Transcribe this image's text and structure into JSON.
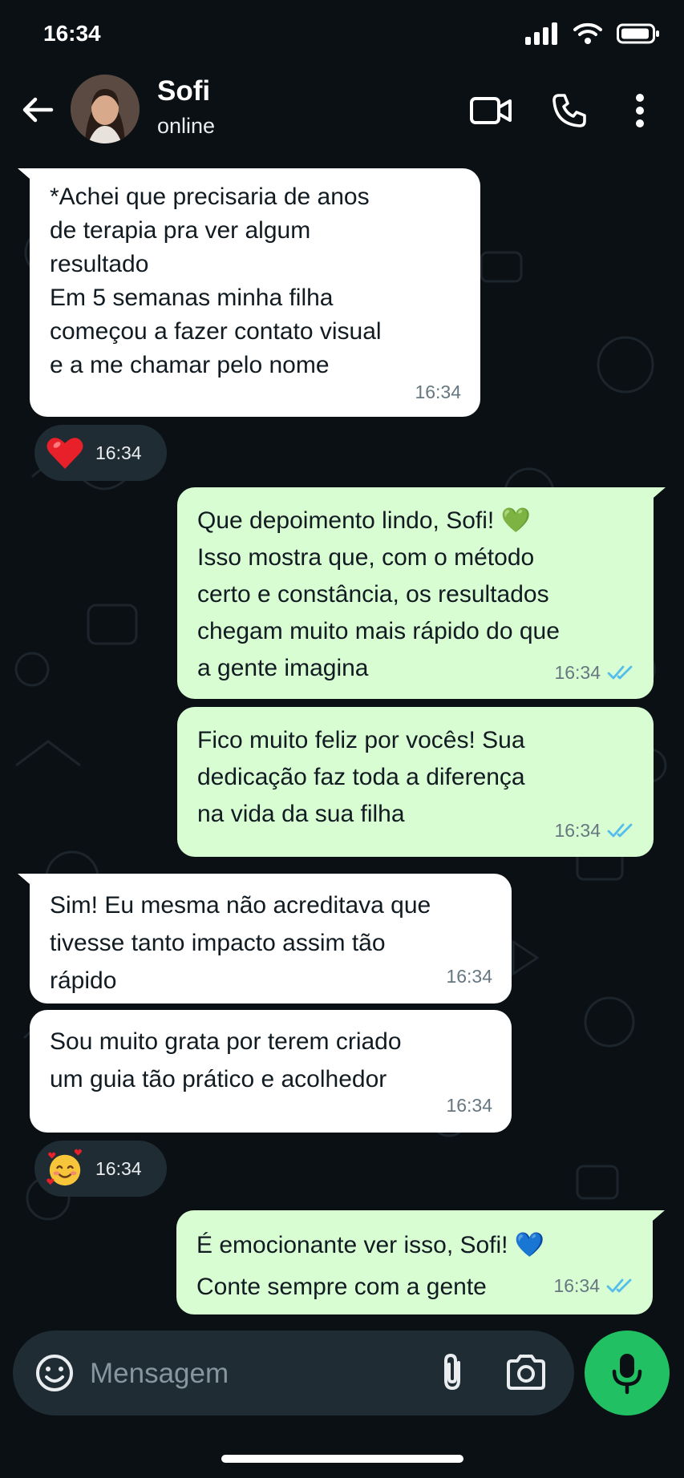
{
  "status_bar": {
    "time": "16:34"
  },
  "header": {
    "contact_name": "Sofi",
    "contact_status": "online",
    "icons": [
      "back-arrow-icon",
      "video-call-icon",
      "phone-icon",
      "more-vert-icon"
    ]
  },
  "messages": [
    {
      "direction": "in",
      "text": "*Achei que precisaria de anos\nde terapia pra ver algum\nresultado\nEm 5 semanas minha filha\ncomeçou a fazer contato visual\ne a me chamar pelo nome",
      "time": "16:34"
    },
    {
      "direction": "in",
      "emoji": "❤️",
      "time": "16:34"
    },
    {
      "direction": "out",
      "text": "Que depoimento lindo, Sofi! 💚\nIsso mostra que, com o método\ncerto e constância, os resultados\nchegam muito mais rápido do que\na gente imagina",
      "time": "16:34",
      "read": true
    },
    {
      "direction": "out",
      "text": "Fico muito feliz por vocês! Sua\ndedicação faz toda a diferença\nna vida da sua filha",
      "time": "16:34",
      "read": true
    },
    {
      "direction": "in",
      "text": "Sim! Eu mesma não acreditava que\ntivesse tanto impacto assim tão\nrápido",
      "time": "16:34"
    },
    {
      "direction": "in",
      "text": "Sou muito grata por terem criado\num guia tão prático e acolhedor",
      "time": "16:34"
    },
    {
      "direction": "in",
      "emoji": "🥰",
      "time": "16:34"
    },
    {
      "direction": "out",
      "text": "É emocionante ver isso, Sofi! 💙\nConte sempre com a gente",
      "time": "16:34",
      "read": true
    }
  ],
  "composer": {
    "placeholder": "Mensagem",
    "icons": [
      "emoji-icon",
      "attach-icon",
      "camera-icon",
      "mic-icon"
    ]
  },
  "colors": {
    "background": "#0b1014",
    "incoming_bubble": "#ffffff",
    "outgoing_bubble": "#d9fdd3",
    "read_ticks": "#53bdeb",
    "mic_button": "#21c063"
  }
}
